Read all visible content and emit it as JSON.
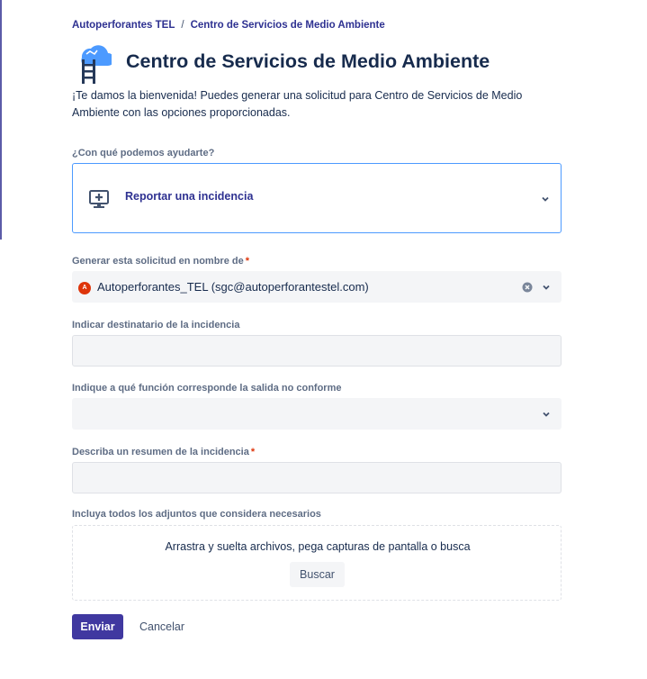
{
  "breadcrumb": {
    "org": "Autoperforantes TEL",
    "separator": "/",
    "project": "Centro de Servicios de Medio Ambiente"
  },
  "header": {
    "icon": "cloud-ladder-icon",
    "title": "Centro de Servicios de Medio Ambiente",
    "intro": "¡Te damos la bienvenida! Puedes generar una solicitud para Centro de Servicios de Medio Ambiente con las opciones proporcionadas."
  },
  "request_type": {
    "label": "¿Con qué podemos ayudarte?",
    "selected": "Reportar una incidencia",
    "icon": "add-screen-icon"
  },
  "on_behalf": {
    "label": "Generar esta solicitud en nombre de",
    "required_mark": "*",
    "avatar_letter": "A",
    "value": "Autoperforantes_TEL (sgc@autoperforantestel.com)"
  },
  "recipient": {
    "label": "Indicar destinatario de la incidencia",
    "value": ""
  },
  "function": {
    "label": "Indique a qué función corresponde la salida no conforme",
    "value": ""
  },
  "summary": {
    "label": "Describa un resumen de la incidencia",
    "required_mark": "*",
    "value": ""
  },
  "attachments": {
    "label": "Incluya todos los adjuntos que considera necesarios",
    "dropzone_text": "Arrastra y suelta archivos, pega capturas de pantalla o busca",
    "browse_label": "Buscar"
  },
  "actions": {
    "submit_label": "Enviar",
    "cancel_label": "Cancelar"
  },
  "colors": {
    "accent": "#2e3191",
    "primary_button": "#4038a0",
    "focus_border": "#4c9aff",
    "required": "#de350b"
  }
}
